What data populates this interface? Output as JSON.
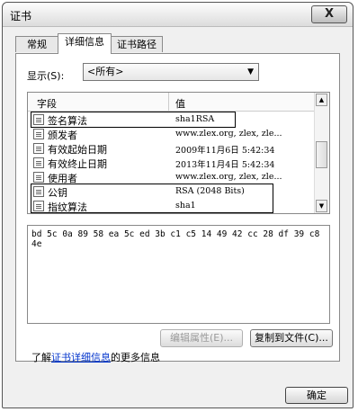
{
  "window": {
    "title": "证书",
    "close_label": "X"
  },
  "tabs": [
    {
      "label": "常规"
    },
    {
      "label": "详细信息"
    },
    {
      "label": "证书路径"
    }
  ],
  "show": {
    "label": "显示(S):",
    "selected": "<所有>"
  },
  "list": {
    "headers": {
      "field": "字段",
      "value": "值"
    },
    "rows": [
      {
        "field": "签名算法",
        "value": "sha1RSA"
      },
      {
        "field": "颁发者",
        "value": "www.zlex.org, zlex, zle..."
      },
      {
        "field": "有效起始日期",
        "value": "2009年11月6日 5:42:34"
      },
      {
        "field": "有效终止日期",
        "value": "2013年11月4日 5:42:34"
      },
      {
        "field": "使用者",
        "value": "www.zlex.org, zlex, zle..."
      },
      {
        "field": "公钥",
        "value": "RSA (2048 Bits)"
      },
      {
        "field": "指纹算法",
        "value": "sha1"
      }
    ]
  },
  "detail_text": "bd 5c 0a 89 58 ea 5c ed 3b c1 c5 14 49 42 cc 28 df 39 c8 4e",
  "buttons": {
    "edit_properties": "编辑属性(E)...",
    "copy_to_file": "复制到文件(C)...",
    "ok": "确定"
  },
  "more_info": {
    "prefix": "了解",
    "link": "证书详细信息",
    "suffix": "的更多信息"
  }
}
